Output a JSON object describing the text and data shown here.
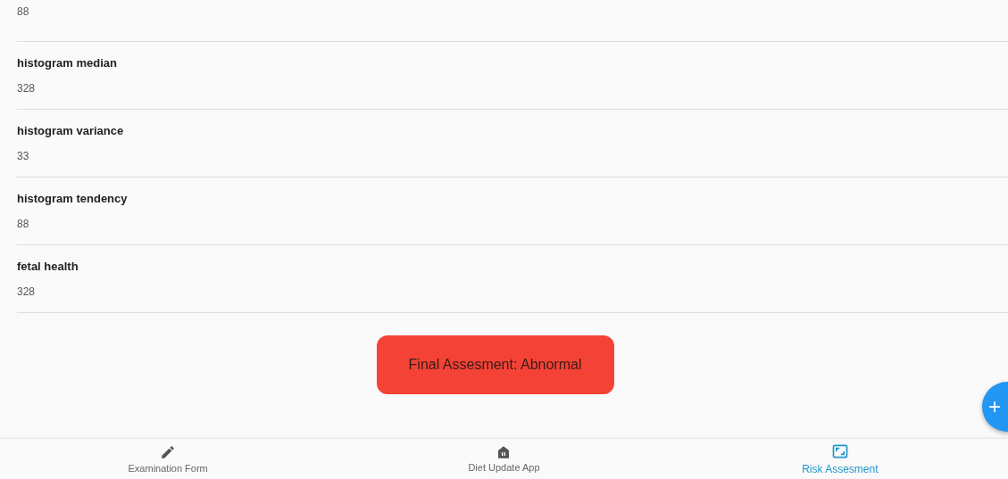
{
  "fields": [
    {
      "value": "88"
    },
    {
      "label": "histogram median",
      "value": "328"
    },
    {
      "label": "histogram variance",
      "value": "33"
    },
    {
      "label": "histogram tendency",
      "value": "88"
    },
    {
      "label": "fetal health",
      "value": "328"
    }
  ],
  "assessment": {
    "text": "Final Assesment: Abnormal",
    "color": "#f44336"
  },
  "fab": {
    "symbol": "+"
  },
  "nav": [
    {
      "kind": "pencil",
      "label": "Examination Form",
      "selected": false
    },
    {
      "kind": "house",
      "label": "Diet Update App",
      "selected": false
    },
    {
      "kind": "frame",
      "label": "Risk Assesment",
      "selected": true
    }
  ]
}
